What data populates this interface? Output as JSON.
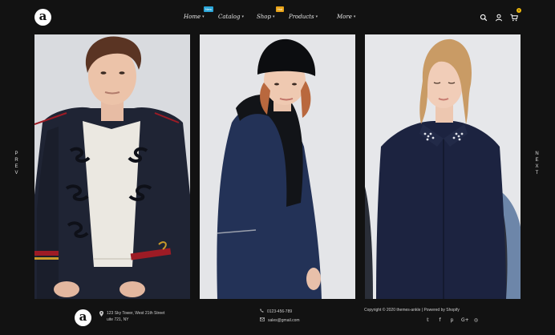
{
  "brand": {
    "logo_letter": "a"
  },
  "nav": {
    "items": [
      {
        "label": "Home",
        "badge": "New",
        "badge_color": "#2ba6d9"
      },
      {
        "label": "Catalog",
        "badge": "",
        "badge_color": ""
      },
      {
        "label": "Shop",
        "badge": "Hot",
        "badge_color": "#e8a317"
      },
      {
        "label": "Products",
        "badge": "",
        "badge_color": ""
      },
      {
        "label": "More",
        "badge": "",
        "badge_color": ""
      }
    ]
  },
  "header_icons": {
    "search": "search-icon",
    "account": "user-icon",
    "cart": "cart-icon",
    "cart_count": "0",
    "cart_badge_color": "#f0b90b"
  },
  "slider": {
    "prev_label": "PREV",
    "next_label": "NEXT",
    "slides": [
      {
        "subject": "man-navy-military-jacket"
      },
      {
        "subject": "woman-navy-coat-beanie"
      },
      {
        "subject": "woman-navy-shirt-embellished-collar"
      }
    ]
  },
  "footer": {
    "logo_letter": "a",
    "address_line1": "123 Sky Tower, West 21th Street",
    "address_line2": "uite 721, NY",
    "phone": "0123-456-789",
    "email": "sales@gmail.com",
    "copyright": "Copyright © 2020 themes-ankle | Powered by Shopify",
    "socials": [
      "twitter-icon",
      "facebook-icon",
      "pinterest-icon",
      "google-plus-icon",
      "instagram-icon"
    ],
    "social_glyphs": [
      "𝕥",
      "f",
      "p",
      "G+",
      "◎"
    ]
  },
  "colors": {
    "background": "#121212",
    "accent_new": "#2ba6d9",
    "accent_hot": "#e8a317"
  }
}
